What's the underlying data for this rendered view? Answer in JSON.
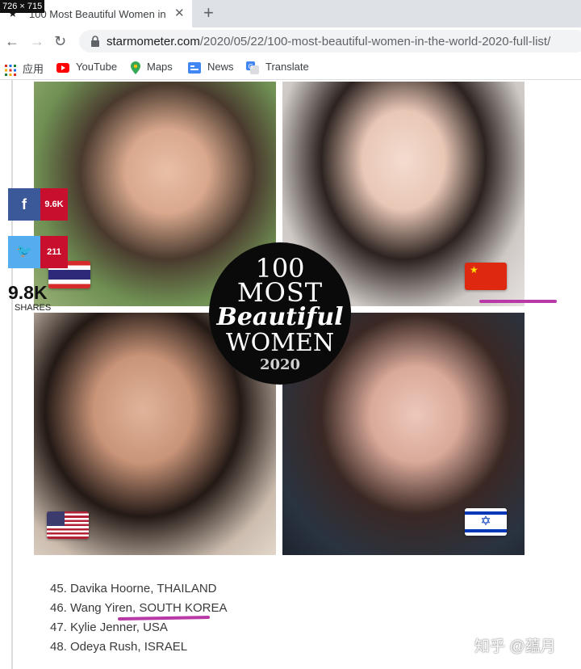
{
  "screenshot_label": "726 × 715",
  "tab": {
    "title": "100 Most Beautiful Women in"
  },
  "toolbar": {
    "url_host": "starmometer.com",
    "url_path": "/2020/05/22/100-most-beautiful-women-in-the-world-2020-full-list/"
  },
  "bookmarks": [
    {
      "label": "应用",
      "icon": "apps-grid-icon"
    },
    {
      "label": "YouTube",
      "icon": "youtube-icon"
    },
    {
      "label": "Maps",
      "icon": "maps-pin-icon"
    },
    {
      "label": "News",
      "icon": "news-icon"
    },
    {
      "label": "Translate",
      "icon": "translate-icon"
    }
  ],
  "share": {
    "facebook_count": "9.6K",
    "twitter_count": "211",
    "total": "9.8K",
    "total_label": "SHARES"
  },
  "collage_logo": {
    "line1": "100",
    "line2": "MOST",
    "line3": "Beautiful",
    "line4": "WOMEN",
    "line5": "2020"
  },
  "flags": [
    "Thailand",
    "China",
    "USA",
    "Israel"
  ],
  "list": [
    {
      "prefix": "45. Davika Hoorne, ",
      "country": "THAILAND"
    },
    {
      "prefix": "46. Wang Yiren, ",
      "country": "SOUTH KOREA"
    },
    {
      "prefix": "47. Kylie Jenner, ",
      "country": "USA"
    },
    {
      "prefix": "48. Odeya Rush, ",
      "country": "ISRAEL"
    }
  ],
  "watermark": "知乎 @蕴月",
  "colors": {
    "highlight": "#b93aa6",
    "facebook": "#3b5998",
    "twitter": "#55acee",
    "count_badge": "#c8102e"
  }
}
